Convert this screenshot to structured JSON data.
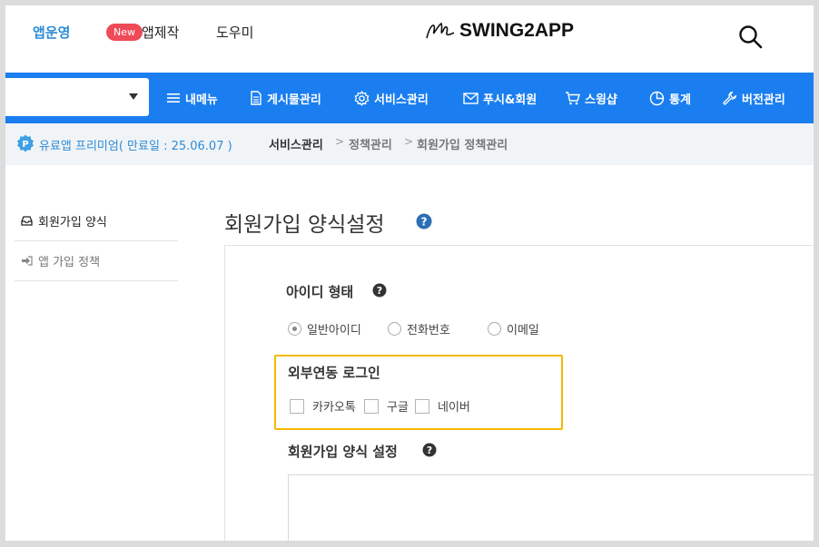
{
  "header": {
    "nav_app_manage": "앱운영",
    "new_badge": "New",
    "nav_app_make": "앱제작",
    "nav_helper": "도우미",
    "logo_text": "SWING2APP"
  },
  "blue_nav": {
    "items": [
      {
        "label": "내메뉴",
        "icon": "menu-icon"
      },
      {
        "label": "게시물관리",
        "icon": "document-icon"
      },
      {
        "label": "서비스관리",
        "icon": "gear-icon"
      },
      {
        "label": "푸시&회원",
        "icon": "mail-icon"
      },
      {
        "label": "스윙샵",
        "icon": "cart-icon"
      },
      {
        "label": "통계",
        "icon": "pie-chart-icon"
      },
      {
        "label": "버전관리",
        "icon": "wrench-icon"
      }
    ]
  },
  "breadcrumb": {
    "plan": "유료앱 프리미엄( 만료일 : 25.06.07 )",
    "plan_badge": "P",
    "crumb1": "서비스관리",
    "crumb2": "정책관리",
    "crumb3": "회원가입 정책관리",
    "separator": ">"
  },
  "sidebar": {
    "items": [
      {
        "label": "회원가입 양식",
        "icon": "inbox-icon"
      },
      {
        "label": "앱 가입 정책",
        "icon": "sign-in-icon"
      }
    ]
  },
  "main": {
    "title": "회원가입 양식설정",
    "id_type": {
      "title": "아이디 형태",
      "options": [
        "일반아이디",
        "전화번호",
        "이메일"
      ],
      "selected": "일반아이디"
    },
    "external_login": {
      "title": "외부연동 로그인",
      "options": [
        "카카오톡",
        "구글",
        "네이버"
      ]
    },
    "signup_form": {
      "title": "회원가입 양식 설정"
    }
  },
  "colors": {
    "accent_blue": "#1a7ef0",
    "link_blue": "#2c8bd6",
    "new_badge": "#ef4a57",
    "highlight": "#f6b800"
  }
}
